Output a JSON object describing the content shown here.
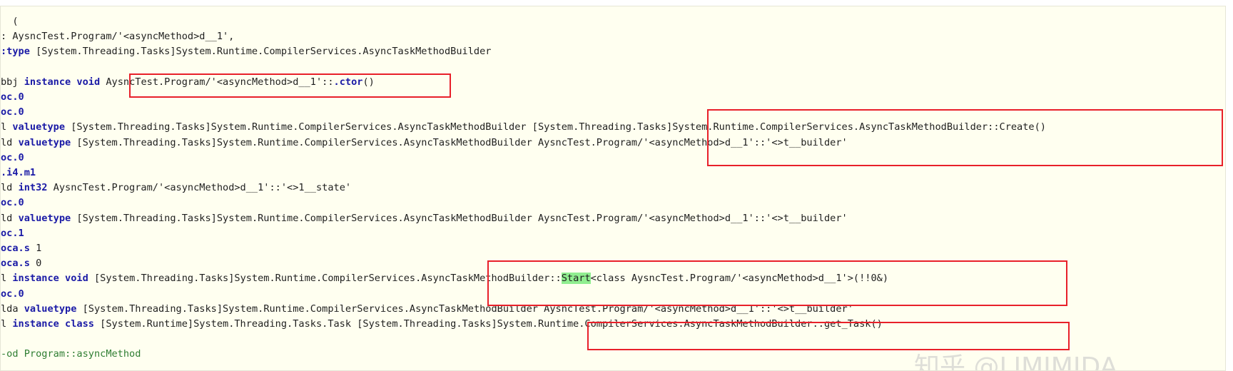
{
  "lines": [
    {
      "text": "  ("
    },
    {
      "text": ": AysncTest.Program/'<asyncMethod>d__1',"
    },
    {
      "kw": ":type",
      "text": " [System.Threading.Tasks]System.Runtime.CompilerServices.AsyncTaskMethodBuilder"
    },
    {
      "text": ""
    },
    {
      "pre": "bbj ",
      "kw": "instance void",
      "text": " AysncTest.Program/'<asyncMethod>d__1'::",
      "kw2": ".ctor",
      "post": "()"
    },
    {
      "kw": "oc.0",
      "text": ""
    },
    {
      "kw": "oc.0",
      "text": ""
    },
    {
      "pre": "l ",
      "kw": "valuetype",
      "text": " [System.Threading.Tasks]System.Runtime.CompilerServices.AsyncTaskMethodBuilder [System.Threading.Tasks]System.Runtime.CompilerServices.AsyncTaskMethodBuilder::Create()"
    },
    {
      "pre": "ld ",
      "kw": "valuetype",
      "text": " [System.Threading.Tasks]System.Runtime.CompilerServices.AsyncTaskMethodBuilder AysncTest.Program/'<asyncMethod>d__1'::'<>t__builder'"
    },
    {
      "kw": "oc.0",
      "text": ""
    },
    {
      "kw": ".i4.m1",
      "text": ""
    },
    {
      "pre": "ld ",
      "kw": "int32",
      "text": " AysncTest.Program/'<asyncMethod>d__1'::'<>1__state'"
    },
    {
      "kw": "oc.0",
      "text": ""
    },
    {
      "pre": "ld ",
      "kw": "valuetype",
      "text": " [System.Threading.Tasks]System.Runtime.CompilerServices.AsyncTaskMethodBuilder AysncTest.Program/'<asyncMethod>d__1'::'<>t__builder'"
    },
    {
      "kw": "oc.1",
      "text": ""
    },
    {
      "kw": "oca.s",
      "text": " 1"
    },
    {
      "kw": "oca.s",
      "text": " 0"
    },
    {
      "pre": "l ",
      "kw": "instance void",
      "text": " [System.Threading.Tasks]System.Runtime.CompilerServices.AsyncTaskMethodBuilder::",
      "hl": "Start",
      "post": "<class AysncTest.Program/'<asyncMethod>d__1'>(!!0&)"
    },
    {
      "kw": "oc.0",
      "text": ""
    },
    {
      "pre": "lda ",
      "kw": "valuetype",
      "text": " [System.Threading.Tasks]System.Runtime.CompilerServices.AsyncTaskMethodBuilder AysncTest.Program/'<asyncMethod>d__1'::'<>t__builder'"
    },
    {
      "pre": "l ",
      "kw": "instance class",
      "text": " [System.Runtime]System.Threading.Tasks.Task [System.Threading.Tasks]System.Runtime.CompilerServices.AsyncTaskMethodBuilder::get_Task()"
    },
    {
      "text": ""
    },
    {
      "green": "-od Program::asyncMethod"
    }
  ],
  "watermark": "知乎 @LIMIMIDA"
}
